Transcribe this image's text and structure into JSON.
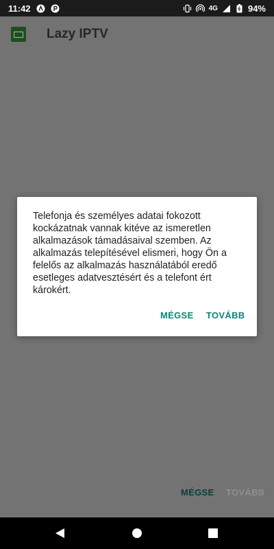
{
  "status_bar": {
    "time": "11:42",
    "network": "4G",
    "battery": "94%",
    "left_icons": [
      "app-a-icon",
      "parking-p-icon"
    ],
    "right_icons": [
      "vibrate-icon",
      "hotspot-icon",
      "signal-icon",
      "battery-icon"
    ]
  },
  "app": {
    "title": "Lazy IPTV",
    "icon": "lazy-iptv-app-icon",
    "bottom_buttons": {
      "cancel": "MÉGSE",
      "next": "TOVÁBB"
    }
  },
  "dialog": {
    "message": "Telefonja és személyes adatai fokozott kockázatnak vannak kitéve az ismeretlen alkalmazások támadásaival szemben. Az alkalmazás telepítésével elismeri, hogy Ön a felelős az alkalmazás használatából eredő esetleges adatvesztésért és a telefont ért károkért.",
    "cancel_label": "MÉGSE",
    "continue_label": "TOVÁBB",
    "accent_color": "#00897b"
  },
  "nav_bar": {
    "icons": [
      "back-icon",
      "home-icon",
      "recents-icon"
    ]
  }
}
